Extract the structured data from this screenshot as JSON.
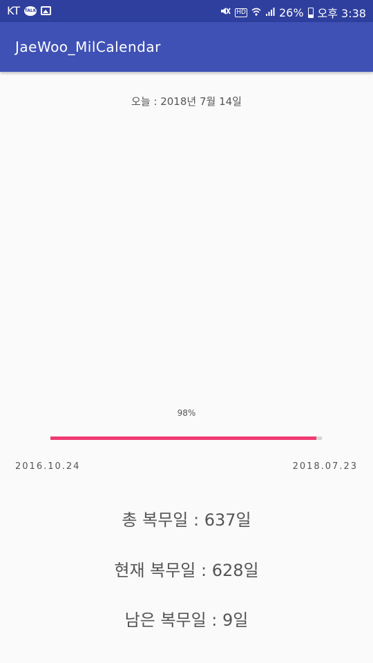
{
  "status_bar": {
    "carrier": "KT",
    "talk_icon_text": "TALK",
    "hd_text": "HD",
    "battery": "26%",
    "time": "오후 3:38",
    "icons": [
      "kakaotalk-icon",
      "image-icon",
      "mute-icon",
      "hd-voice-icon",
      "wifi-icon",
      "signal-icon",
      "battery-icon"
    ]
  },
  "app_bar": {
    "title": "JaeWoo_MilCalendar",
    "color": "#3f51b5"
  },
  "main": {
    "today": "오늘 : 2018년 7월 14일",
    "percent_label": "98%",
    "progress_percent": 98,
    "progress_color": "#ef3b74",
    "start_date": "2016.10.24",
    "end_date": "2018.07.23",
    "total_days": "총 복무일 : 637일",
    "current_days": "현재 복무일 : 628일",
    "remaining_days": "남은 복무일 : 9일"
  }
}
